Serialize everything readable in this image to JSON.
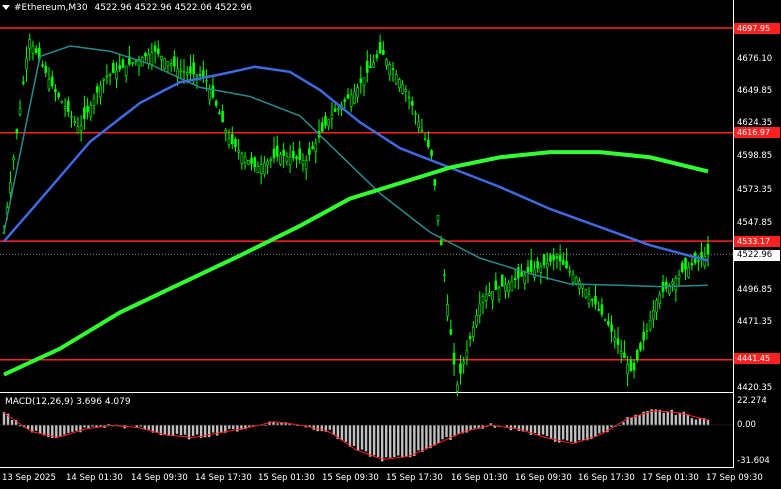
{
  "header": {
    "symbol": "#Ethereum,M30",
    "ohlc": "4522.96 4522.96 4522.06 4522.96"
  },
  "macd_label": "MACD(12,26,9) 3.696 4.079",
  "price_axis": [
    "4676.10",
    "4649.85",
    "4624.35",
    "4598.85",
    "4573.35",
    "4547.85",
    "4496.85",
    "4471.35",
    "4420.35"
  ],
  "macd_axis": [
    "22.274",
    "0.00",
    "-31.604"
  ],
  "levels": [
    "4697.95",
    "4616.97",
    "4533.17",
    "4441.45"
  ],
  "current_price": "4522.96",
  "time_axis": [
    "13 Sep 2025",
    "14 Sep 01:30",
    "14 Sep 09:30",
    "14 Sep 17:30",
    "15 Sep 01:30",
    "15 Sep 09:30",
    "15 Sep 17:30",
    "16 Sep 01:30",
    "16 Sep 09:30",
    "16 Sep 17:30",
    "17 Sep 01:30",
    "17 Sep 09:30"
  ],
  "colors": {
    "background": "#000000",
    "candle": "#00ff00",
    "ma_fast": "#2a8a8a",
    "ma_mid": "#4169e1",
    "ma_slow": "#32ff32",
    "level_line": "#ff2020",
    "macd_hist": "#c0c0c0",
    "macd_signal": "#ff2020",
    "grid_border": "#ffffff"
  },
  "chart_data": {
    "type": "candlestick",
    "series": [
      {
        "name": "price_close",
        "x_range": [
          "13 Sep 2025",
          "17 Sep 09:30"
        ],
        "values": [
          4540,
          4690,
          4650,
          4620,
          4660,
          4670,
          4680,
          4665,
          4660,
          4610,
          4590,
          4600,
          4595,
          4630,
          4650,
          4680,
          4650,
          4600,
          4420,
          4490,
          4500,
          4510,
          4520,
          4500,
          4470,
          4430,
          4490,
          4510,
          4522.96
        ]
      },
      {
        "name": "macd_signal",
        "values": [
          10,
          -5,
          -10,
          -3,
          0,
          -2,
          -8,
          -10,
          -6,
          -2,
          3,
          0,
          -5,
          -20,
          -28,
          -25,
          -15,
          -5,
          0,
          -3,
          -10,
          -15,
          -8,
          5,
          12,
          10,
          4
        ]
      }
    ],
    "ylim": [
      4420.35,
      4697.95
    ],
    "levels": [
      4697.95,
      4616.97,
      4533.17,
      4441.45
    ]
  }
}
